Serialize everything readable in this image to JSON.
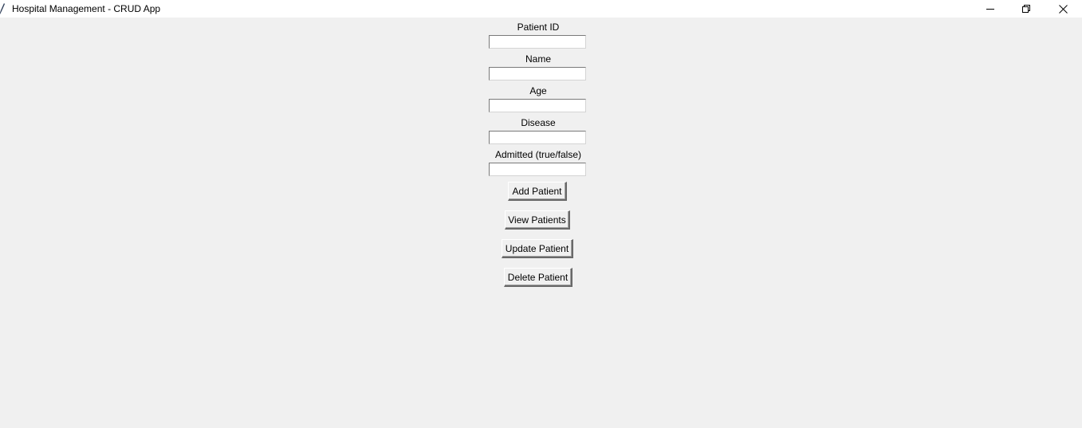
{
  "window": {
    "title": "Hospital Management - CRUD App",
    "controls": {
      "minimize": "minimize-icon",
      "maximize": "restore-icon",
      "close": "close-icon"
    }
  },
  "form": {
    "fields": [
      {
        "label": "Patient ID",
        "value": ""
      },
      {
        "label": "Name",
        "value": ""
      },
      {
        "label": "Age",
        "value": ""
      },
      {
        "label": "Disease",
        "value": ""
      },
      {
        "label": "Admitted (true/false)",
        "value": ""
      }
    ],
    "buttons": {
      "add": "Add Patient",
      "view": "View Patients",
      "update": "Update Patient",
      "delete": "Delete Patient"
    }
  }
}
